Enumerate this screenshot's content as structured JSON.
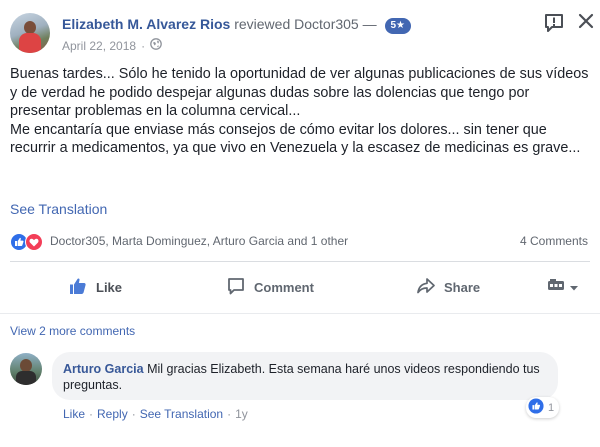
{
  "post": {
    "author": "Elizabeth M. Alvarez Rios",
    "verb": "reviewed",
    "page": "Doctor305",
    "dash": "—",
    "rating": "5★",
    "date": "April 22, 2018",
    "dot": "·",
    "body": "Buenas tardes... Sólo he tenido la oportunidad de ver algunas publicaciones de sus vídeos y de verdad he podido despejar algunas dudas sobre las dolencias que tengo por presentar problemas en la columna cervical...\nMe encantaría que enviase más consejos de cómo evitar los dolores... sin tener que recurrir a medicamentos, ya que vivo en Venezuela y la escasez de medicinas es grave...",
    "see_translation": "See Translation",
    "reactions_names": "Doctor305, Marta Dominguez, Arturo Garcia and 1 other",
    "comments_count": "4 Comments"
  },
  "actions": {
    "like": "Like",
    "comment": "Comment",
    "share": "Share"
  },
  "comments": {
    "view_more": "View 2 more comments",
    "items": [
      {
        "author": "Arturo Garcia",
        "text": "Mil gracias Elizabeth. Esta semana haré unos videos respondiendo tus preguntas.",
        "reaction_count": "1",
        "like": "Like",
        "reply": "Reply",
        "see_translation": "See Translation",
        "time": "1y",
        "sep": "·"
      }
    ]
  },
  "icons": {
    "report": "report-icon",
    "close": "close-icon",
    "globe": "globe-icon",
    "like_reaction": "like-reaction-icon",
    "love_reaction": "love-reaction-icon",
    "thumb": "thumb-up-icon",
    "comment": "comment-bubble-icon",
    "share": "share-arrow-icon",
    "audience": "audience-icon",
    "chevron": "chevron-down-icon"
  },
  "colors": {
    "link": "#365899",
    "accent": "#4267b2",
    "love": "#f33e58"
  }
}
